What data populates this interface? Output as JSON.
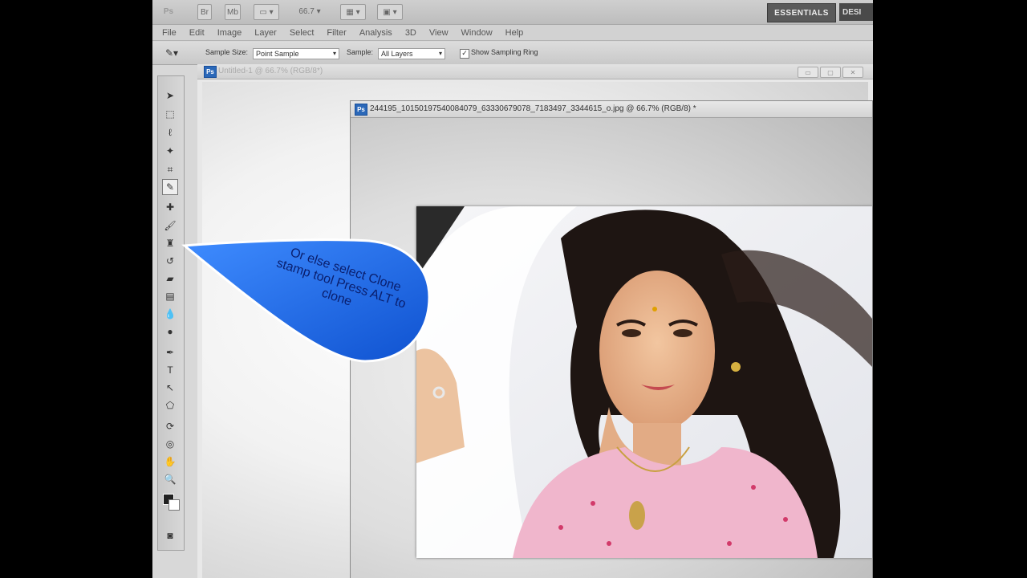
{
  "appbar": {
    "zoom": "66.7",
    "workspace": "ESSENTIALS",
    "workspace2": "DESI"
  },
  "menu": [
    "File",
    "Edit",
    "Image",
    "Layer",
    "Select",
    "Filter",
    "Analysis",
    "3D",
    "View",
    "Window",
    "Help"
  ],
  "options": {
    "sample_size_label": "Sample Size:",
    "sample_size_value": "Point Sample",
    "sample_label": "Sample:",
    "sample_value": "All Layers",
    "show_ring_label": "Show Sampling Ring",
    "show_ring_checked": true
  },
  "doc1": {
    "title": "Untitled-1 @ 66.7% (RGB/8*)"
  },
  "doc2": {
    "title": "244195_10150197540084079_63330679078_7183497_3344615_o.jpg @ 66.7% (RGB/8) *"
  },
  "callout": {
    "text": "Or else select Clone stamp tool Press ALT to clone",
    "color": "#1a6fe8"
  },
  "tools": [
    "move-icon",
    "marquee-icon",
    "lasso-icon",
    "quick-select-icon",
    "crop-icon",
    "eyedropper-icon",
    "healing-brush-icon",
    "brush-icon",
    "clone-stamp-icon",
    "history-brush-icon",
    "eraser-icon",
    "gradient-icon",
    "blur-icon",
    "dodge-icon",
    "pen-icon",
    "type-icon",
    "path-select-icon",
    "shape-icon",
    "3d-rotate-icon",
    "3d-orbit-icon",
    "hand-icon",
    "zoom-icon"
  ]
}
